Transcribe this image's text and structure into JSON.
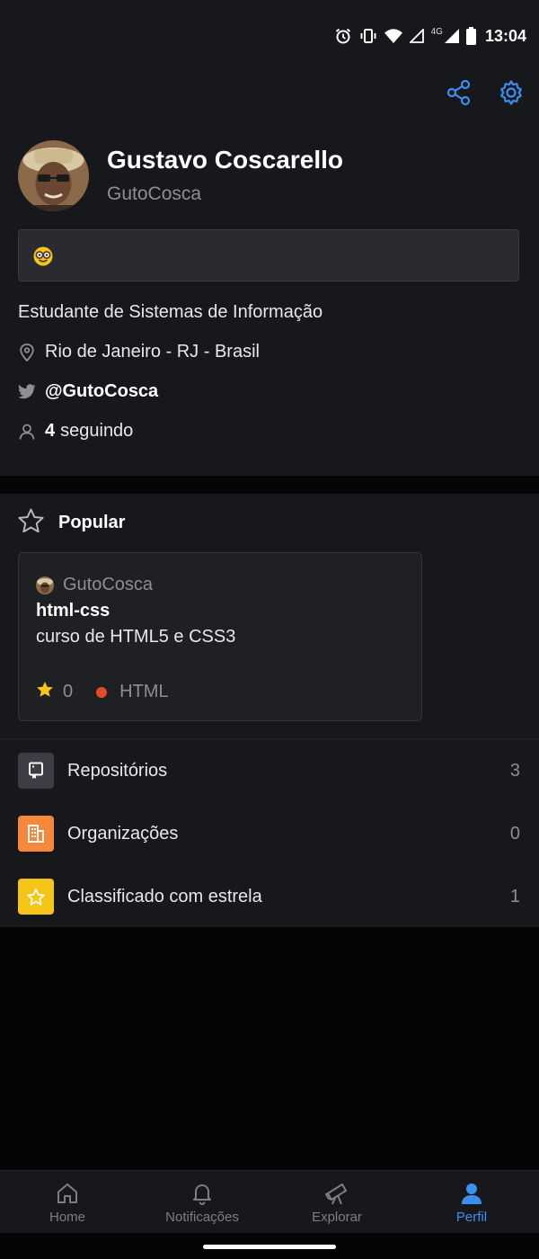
{
  "status_bar": {
    "time": "13:04",
    "network": "4G",
    "icons": [
      "alarm-icon",
      "vibrate-icon",
      "wifi-icon",
      "signal-icon",
      "battery-icon"
    ]
  },
  "header_actions": [
    "share-icon",
    "settings-icon"
  ],
  "profile": {
    "display_name": "Gustavo Coscarello",
    "username": "GutoCosca",
    "status_emoji": "nerd-face-emoji",
    "bio": "Estudante de Sistemas de Informação",
    "location": "Rio de Janeiro - RJ - Brasil",
    "twitter": "@GutoCosca",
    "following_count": "4",
    "following_label": "seguindo"
  },
  "popular": {
    "title": "Popular",
    "repo": {
      "owner": "GutoCosca",
      "name": "html-css",
      "description": "curso de HTML5 e CSS3",
      "stars": "0",
      "language": "HTML",
      "language_color": "#e34c26"
    }
  },
  "menu": [
    {
      "label": "Repositórios",
      "count": "3",
      "icon": "repository-icon",
      "color": "#3d3e45"
    },
    {
      "label": "Organizações",
      "count": "0",
      "icon": "organization-icon",
      "color": "#f5883a"
    },
    {
      "label": "Classificado com estrela",
      "count": "1",
      "icon": "star-icon",
      "color": "#f5c518"
    }
  ],
  "bottom_nav": [
    {
      "label": "Home",
      "icon": "home-icon",
      "active": false
    },
    {
      "label": "Notificações",
      "icon": "bell-icon",
      "active": false
    },
    {
      "label": "Explorar",
      "icon": "telescope-icon",
      "active": false
    },
    {
      "label": "Perfil",
      "icon": "person-icon",
      "active": true
    }
  ],
  "colors": {
    "accent": "#3b8ff0",
    "background": "#17181c",
    "star": "#f5c518"
  }
}
